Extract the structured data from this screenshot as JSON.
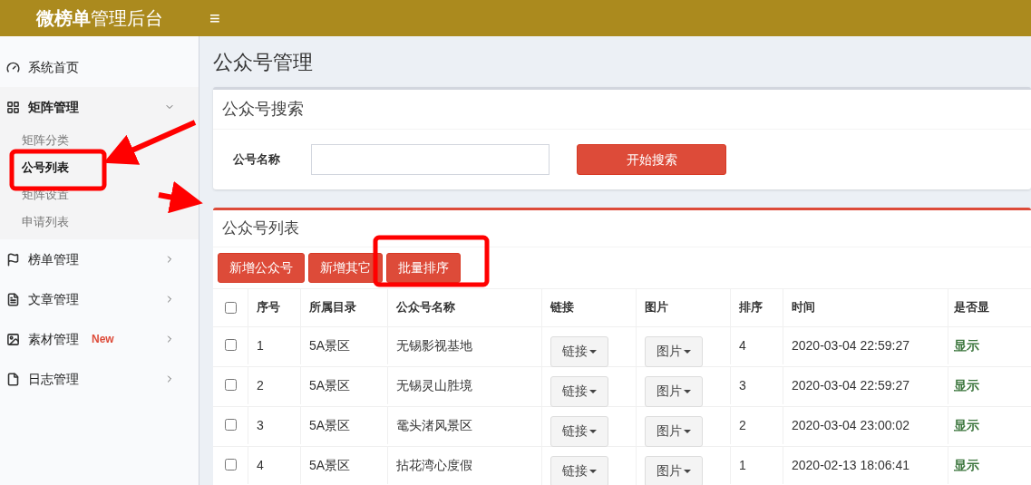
{
  "header": {
    "brand_bold": "微榜单",
    "brand_rest": "管理后台",
    "menu_toggle": "≡"
  },
  "sidebar": {
    "items": [
      {
        "label": "系统首页",
        "expanded": false,
        "has_children": false
      },
      {
        "label": "矩阵管理",
        "expanded": true,
        "has_children": true,
        "children": [
          {
            "label": "矩阵分类",
            "selected": false
          },
          {
            "label": "公号列表",
            "selected": true
          },
          {
            "label": "矩阵设置",
            "selected": false
          },
          {
            "label": "申请列表",
            "selected": false
          }
        ]
      },
      {
        "label": "榜单管理",
        "expanded": false,
        "has_children": true
      },
      {
        "label": "文章管理",
        "expanded": false,
        "has_children": true
      },
      {
        "label": "素材管理",
        "expanded": false,
        "has_children": true,
        "badge": "New"
      },
      {
        "label": "日志管理",
        "expanded": false,
        "has_children": true
      }
    ]
  },
  "page_title": "公众号管理",
  "search_panel": {
    "title": "公众号搜索",
    "field_label": "公号名称",
    "button": "开始搜索"
  },
  "list_panel": {
    "title": "公众号列表",
    "buttons": [
      "新增公众号",
      "新增其它",
      "批量排序"
    ],
    "table": {
      "all_checked": false,
      "columns": [
        "序号",
        "所属目录",
        "公众号名称",
        "链接",
        "图片",
        "排序",
        "时间",
        "是否显"
      ],
      "rows": [
        {
          "checked": false,
          "cells": [
            "1",
            "5A景区",
            "无锡影视基地",
            "链接",
            "图片",
            "4",
            "2020-03-04 22:59:27",
            "显示"
          ]
        },
        {
          "checked": false,
          "cells": [
            "2",
            "5A景区",
            "无锡灵山胜境",
            "链接",
            "图片",
            "3",
            "2020-03-04 22:59:27",
            "显示"
          ]
        },
        {
          "checked": false,
          "cells": [
            "3",
            "5A景区",
            "鼋头渚风景区",
            "链接",
            "图片",
            "2",
            "2020-03-04 23:00:02",
            "显示"
          ]
        },
        {
          "checked": false,
          "cells": [
            "4",
            "5A景区",
            "拈花湾心度假",
            "链接",
            "图片",
            "1",
            "2020-02-13 18:06:41",
            "显示"
          ]
        }
      ]
    }
  }
}
